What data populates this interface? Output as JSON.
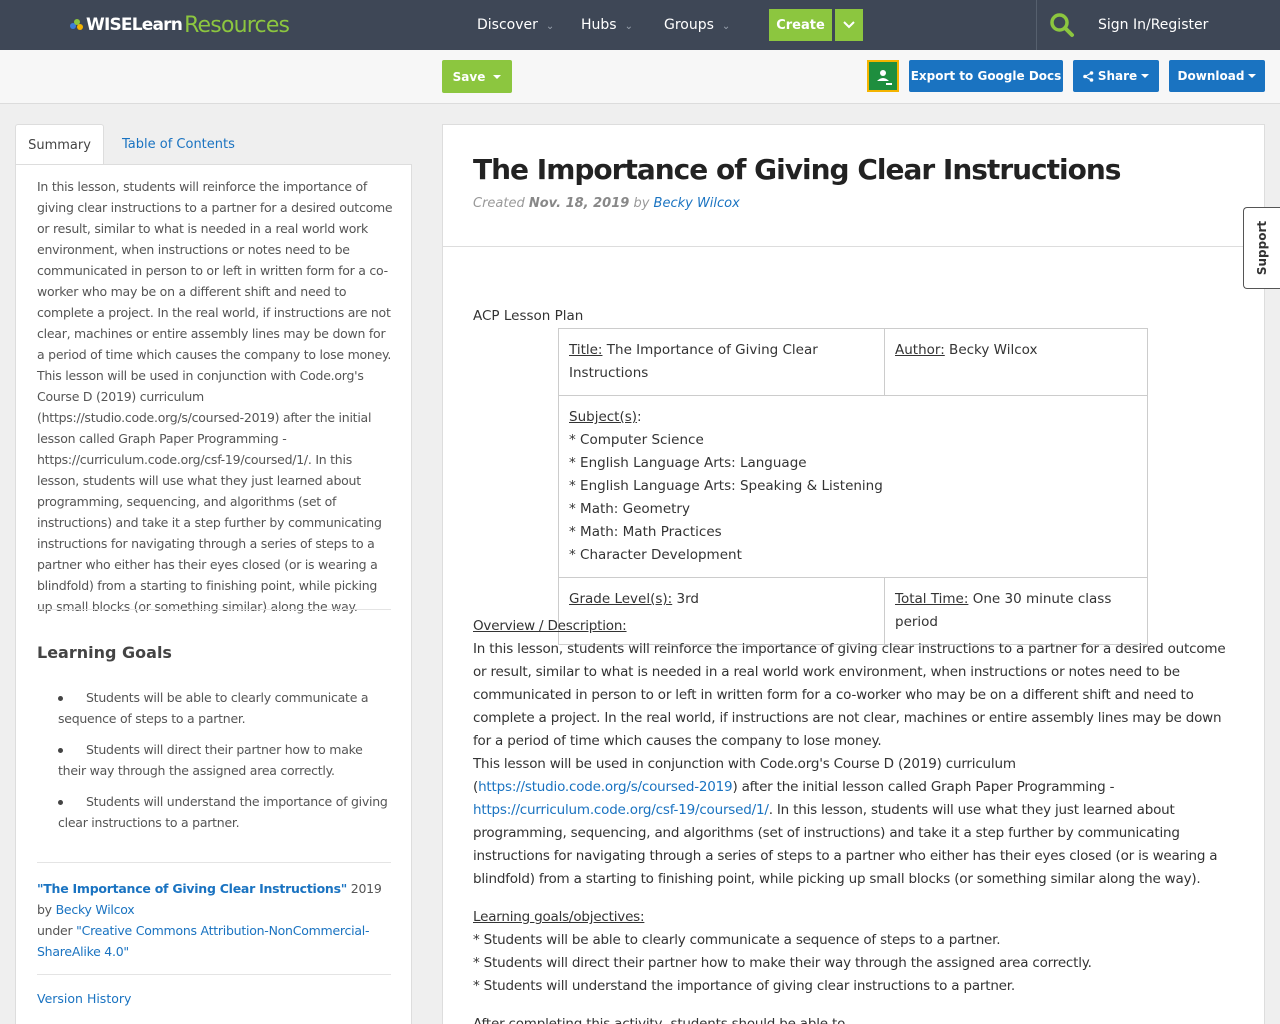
{
  "brand": {
    "wise": "WISELearn",
    "resources": "Resources"
  },
  "nav": {
    "discover": "Discover",
    "hubs": "Hubs",
    "groups": "Groups",
    "create": "Create",
    "signin": "Sign In/Register"
  },
  "toolbar": {
    "save": "Save",
    "export": "Export to Google Docs",
    "share": "Share",
    "download": "Download"
  },
  "tabs": {
    "summary": "Summary",
    "toc": "Table of Contents"
  },
  "sidebar": {
    "summary": "In this lesson, students will reinforce the importance of giving clear instructions to a partner for a desired outcome or result, similar to what is needed in a real world work environment, when instructions or notes need to be communicated in person to or left in written form for a co-worker who may be on a different shift and need to complete a project. In the real world, if instructions are not clear, machines or entire assembly lines may be down for a period of time which causes the company to lose money. This lesson will be used in conjunction with Code.org's Course D (2019) curriculum (https://studio.code.org/s/coursed-2019) after the initial lesson called Graph Paper Programming - https://curriculum.code.org/csf-19/coursed/1/. In this lesson, students will use what they just learned about programming, sequencing, and algorithms (set of instructions) and take it a step further by communicating instructions for navigating through a series of steps to a partner who either has their eyes closed (or is wearing a blindfold) from a starting to finishing point, while picking up small blocks (or something similar) along the way.",
    "goals_heading": "Learning Goals",
    "goals": [
      "Students will be able to clearly communicate a sequence of steps to a partner.",
      "Students will direct their partner how to make their way through the assigned area correctly.",
      "Students will understand the importance of giving clear instructions to a partner."
    ],
    "attrib": {
      "title": "\"The Importance of Giving Clear Instructions\"",
      "year_by": " 2019 by ",
      "author": "Becky Wilcox",
      "under": "under ",
      "license": "\"Creative Commons Attribution-NonCommercial-ShareAlike 4.0\""
    },
    "version_history": "Version History"
  },
  "main": {
    "title": "The Importance of Giving Clear Instructions",
    "created_label": "Created ",
    "created_date": "Nov. 18, 2019",
    "by": " by ",
    "author": "Becky Wilcox",
    "acp": "ACP Lesson Plan",
    "table": {
      "title_label": "Title:",
      "title_value": " The Importance of Giving Clear Instructions",
      "author_label": "Author:",
      "author_value": " Becky Wilcox",
      "subjects_label": "Subject(s)",
      "subjects": [
        "* Computer Science",
        "* English Language Arts: Language",
        "* English Language Arts: Speaking & Listening",
        "* Math: Geometry",
        "* Math: Math Practices",
        "* Character Development"
      ],
      "grade_label": "Grade Level(s):",
      "grade_value": " 3rd",
      "time_label": "Total Time:",
      "time_value": " One 30 minute class period"
    },
    "overview_heading": "Overview / Description:",
    "overview_p1": "In this lesson, students will reinforce the importance of giving clear instructions to a partner for a desired outcome or result, similar to what is needed in a real world work environment, when instructions or notes need to be communicated in person to or left in written form for a co-worker who may be on a different shift and need to complete a project.  In the real world, if instructions are not clear, machines or entire assembly lines may be down for a period of time which causes the company to lose money.",
    "overview_p2a": "This lesson will be used in conjunction with Code.org's Course D (2019) curriculum (",
    "overview_link1": "https://studio.code.org/s/coursed-2019",
    "overview_p2b": ") after the initial lesson called Graph Paper Programming - ",
    "overview_link2": "https://curriculum.code.org/csf-19/coursed/1/",
    "overview_p2c": ".  In this lesson, students will use what they just learned about programming, sequencing, and algorithms (set of instructions) and take it a step further by communicating instructions for navigating through a series of steps to a partner who either has their eyes closed (or is wearing a blindfold) from a starting to finishing point, while picking up small blocks (or something similar along the way).",
    "goals_heading": "Learning goals/objectives:",
    "goals": [
      "* Students will be able to clearly communicate a sequence of steps to a partner.",
      "* Students will direct their partner how to make their way through the assigned area correctly.",
      "* Students will understand the importance of giving clear instructions to a partner."
    ],
    "after": "After completing this activity, students should be able to"
  },
  "support": "Support"
}
